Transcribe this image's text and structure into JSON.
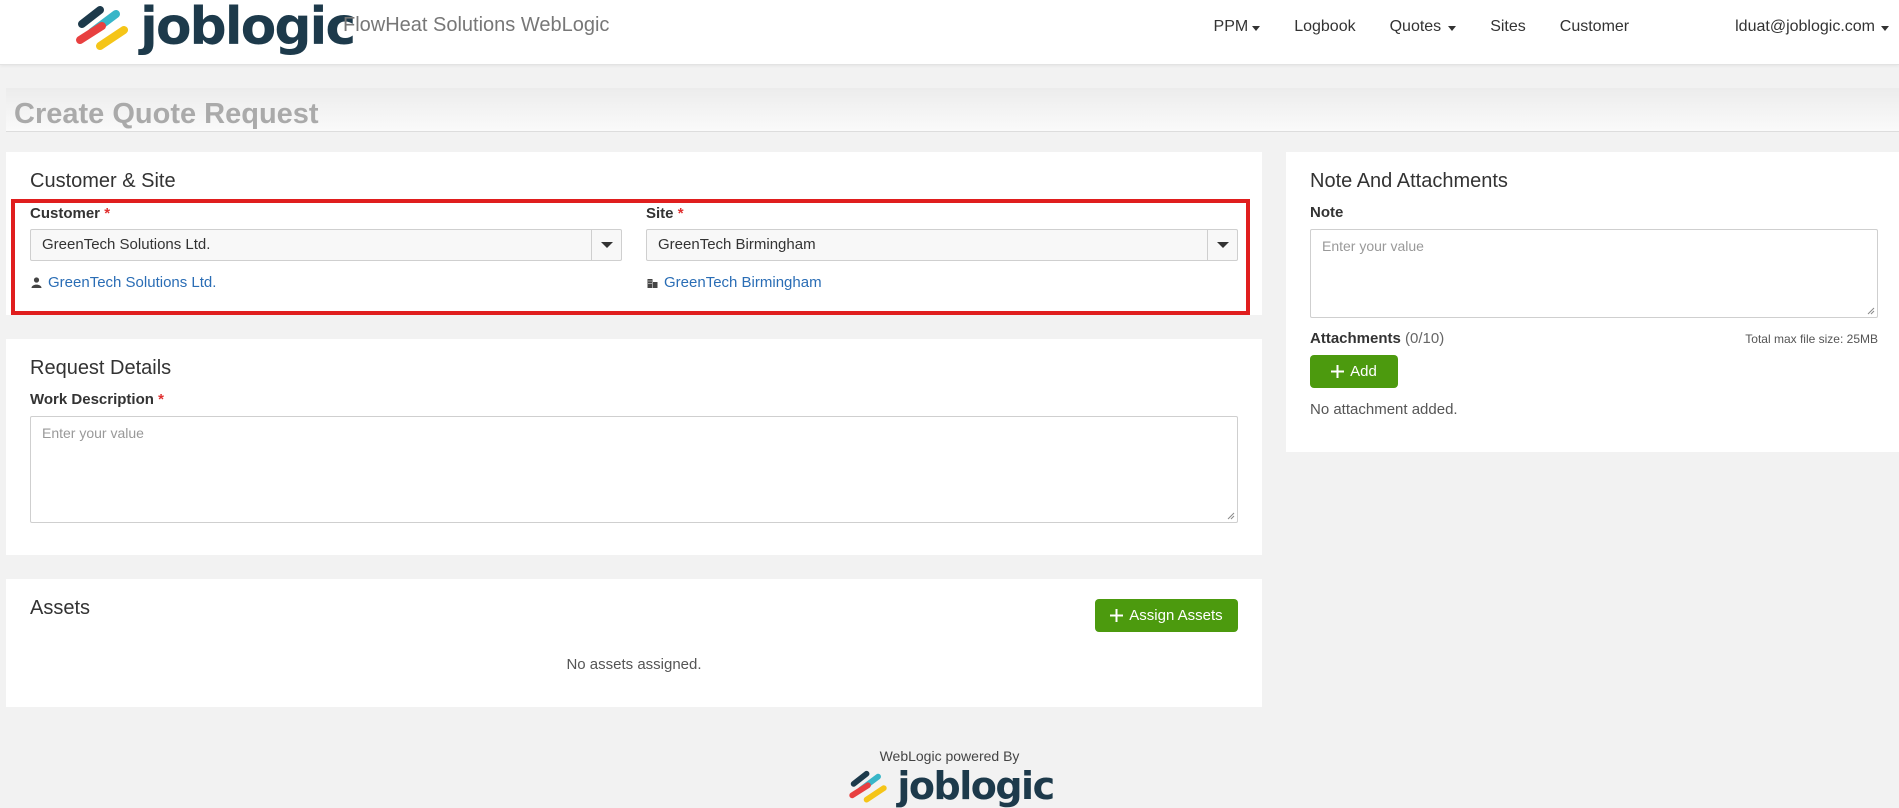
{
  "header": {
    "logo_text": "joblogic",
    "company": "FlowHeat Solutions WebLogic",
    "nav": [
      {
        "label": "PPM",
        "dropdown": true
      },
      {
        "label": "Logbook",
        "dropdown": false
      },
      {
        "label": "Quotes",
        "dropdown": true
      },
      {
        "label": "Sites",
        "dropdown": false
      },
      {
        "label": "Customer",
        "dropdown": false
      }
    ],
    "user_email": "lduat@joblogic.com",
    "accent_color": "#4c9a0e",
    "highlight_color": "#e01e1e"
  },
  "page": {
    "title": "Create Quote Request"
  },
  "customer_site": {
    "title": "Customer & Site",
    "customer_label": "Customer",
    "customer_value": "GreenTech Solutions Ltd.",
    "customer_link": "GreenTech Solutions Ltd.",
    "site_label": "Site",
    "site_value": "GreenTech Birmingham",
    "site_link": "GreenTech Birmingham",
    "required_mark": "*"
  },
  "request_details": {
    "title": "Request Details",
    "work_description_label": "Work Description",
    "work_description_placeholder": "Enter your value",
    "required_mark": "*"
  },
  "assets": {
    "title": "Assets",
    "assign_button": "Assign Assets",
    "empty_text": "No assets assigned."
  },
  "notes": {
    "title": "Note And Attachments",
    "note_label": "Note",
    "note_placeholder": "Enter your value",
    "attachments_label": "Attachments",
    "attachments_count": "(0/10)",
    "max_size": "Total max file size: 25MB",
    "add_button": "Add",
    "empty_text": "No attachment added."
  },
  "footer": {
    "powered_by": "WebLogic powered By",
    "logo_text": "joblogic"
  }
}
